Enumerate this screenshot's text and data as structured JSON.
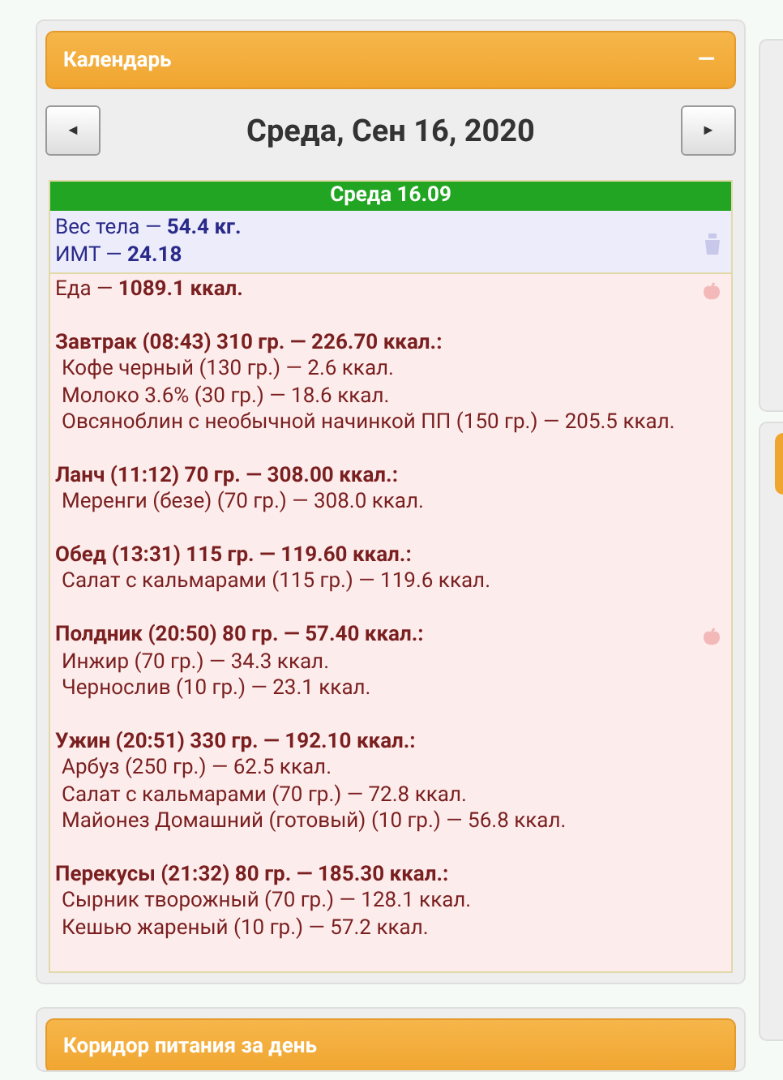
{
  "calendar": {
    "title": "Календарь",
    "collapse": "—",
    "prev": "◄",
    "next": "►",
    "date": "Среда, Сен 16, 2020",
    "day": {
      "header": "Среда 16.09",
      "body": [
        {
          "label": "Вес тела — ",
          "value": "54.4 кг."
        },
        {
          "label": "ИМТ — ",
          "value": "24.18"
        }
      ],
      "food": {
        "label": "Еда — ",
        "value": "1089.1 ккал."
      },
      "meals": [
        {
          "header": "Завтрак (08:43) 310 гр. — 226.70 ккал.:",
          "fruit_icon": false,
          "items": [
            "Кофе черный (130 гр.) — 2.6 ккал.",
            "Молоко 3.6% (30 гр.) — 18.6 ккал.",
            "Овсяноблин с необычной начинкой ПП (150 гр.) — 205.5 ккал."
          ]
        },
        {
          "header": "Ланч (11:12) 70 гр. — 308.00 ккал.:",
          "fruit_icon": false,
          "items": [
            "Меренги (безе) (70 гр.) — 308.0 ккал."
          ]
        },
        {
          "header": "Обед (13:31) 115 гр. — 119.60 ккал.:",
          "fruit_icon": false,
          "items": [
            "Салат с кальмарами (115 гр.) — 119.6 ккал."
          ]
        },
        {
          "header": "Полдник (20:50) 80 гр. — 57.40 ккал.:",
          "fruit_icon": true,
          "items": [
            "Инжир (70 гр.) — 34.3 ккал.",
            "Чернослив (10 гр.) — 23.1 ккал."
          ]
        },
        {
          "header": "Ужин (20:51) 330 гр. — 192.10 ккал.:",
          "fruit_icon": false,
          "items": [
            "Арбуз (250 гр.) — 62.5 ккал.",
            "Салат с кальмарами (70 гр.) — 72.8 ккал.",
            "Майонез Домашний (готовый) (10 гр.) — 56.8 ккал."
          ]
        },
        {
          "header": "Перекусы (21:32) 80 гр. — 185.30 ккал.:",
          "fruit_icon": false,
          "items": [
            "Сырник творожный (70 гр.) — 128.1 ккал.",
            "Кешью жареный (10 гр.) — 57.2 ккал."
          ]
        }
      ]
    }
  },
  "second_panel": {
    "title": "Коридор питания за день"
  }
}
